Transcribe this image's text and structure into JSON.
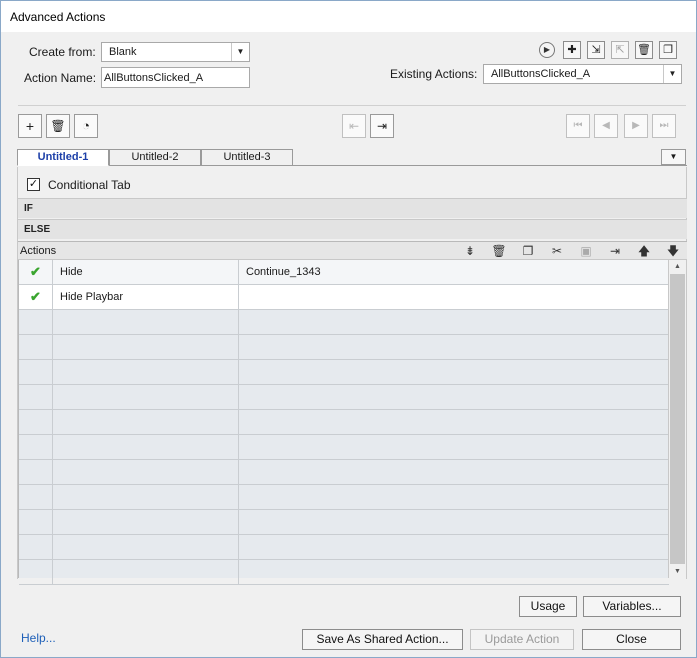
{
  "window": {
    "title": "Advanced Actions"
  },
  "form": {
    "create_from_label": "Create from:",
    "create_from_value": "Blank",
    "action_name_label": "Action Name:",
    "action_name_value": "AllButtonsClicked_A",
    "existing_actions_label": "Existing Actions:",
    "existing_actions_value": "AllButtonsClicked_A"
  },
  "tabs": [
    {
      "label": "Untitled-1",
      "active": true
    },
    {
      "label": "Untitled-2",
      "active": false
    },
    {
      "label": "Untitled-3",
      "active": false
    }
  ],
  "conditional": {
    "label": "Conditional Tab",
    "checked": true
  },
  "sections": {
    "if_label": "IF",
    "else_label": "ELSE"
  },
  "actions": {
    "header": "Actions",
    "rows": [
      {
        "status": "✔",
        "action": "Hide",
        "target": "Continue_1343"
      },
      {
        "status": "✔",
        "action": "Hide Playbar",
        "target": ""
      }
    ],
    "empty_rows": 11
  },
  "buttons": {
    "usage": "Usage",
    "variables": "Variables...",
    "save_shared": "Save As Shared Action...",
    "update": "Update Action",
    "close": "Close",
    "help": "Help..."
  },
  "icons": {
    "preview": "play-circle-icon",
    "add": "plus-icon",
    "import": "import-icon",
    "export": "export-icon",
    "delete": "trash-icon",
    "duplicate": "duplicate-icon"
  }
}
